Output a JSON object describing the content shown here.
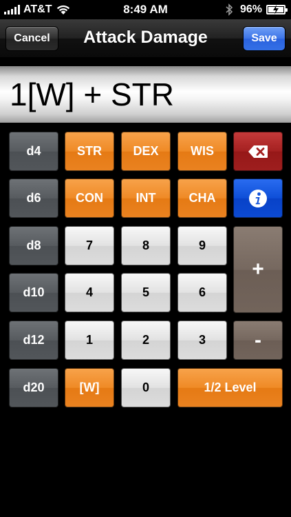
{
  "status_bar": {
    "carrier": "AT&T",
    "time": "8:49 AM",
    "battery": "96%",
    "icons": [
      "signal-icon",
      "wifi-icon",
      "bluetooth-icon",
      "battery-icon"
    ]
  },
  "nav": {
    "title": "Attack Damage",
    "cancel_label": "Cancel",
    "save_label": "Save"
  },
  "display": {
    "expression": "1[W] + STR"
  },
  "keypad": {
    "dice": [
      "d4",
      "d6",
      "d8",
      "d10",
      "d12",
      "d20"
    ],
    "stats_row1": [
      "STR",
      "DEX",
      "WIS"
    ],
    "stats_row2": [
      "CON",
      "INT",
      "CHA"
    ],
    "digits_row1": [
      "7",
      "8",
      "9"
    ],
    "digits_row2": [
      "4",
      "5",
      "6"
    ],
    "digits_row3": [
      "1",
      "2",
      "3"
    ],
    "weapon_label": "[W]",
    "zero_label": "0",
    "half_level_label": "1/2 Level",
    "plus_label": "+",
    "minus_label": "-",
    "backspace_icon": "backspace-icon",
    "info_icon": "info-icon"
  },
  "colors": {
    "orange": "#ef8a26",
    "dark_key": "#575b5f",
    "light_key": "#e2e2e2",
    "red_key": "#a42020",
    "blue_key": "#0e4fd8",
    "taupe_key": "#76685f",
    "save_button": "#3c74e8"
  }
}
